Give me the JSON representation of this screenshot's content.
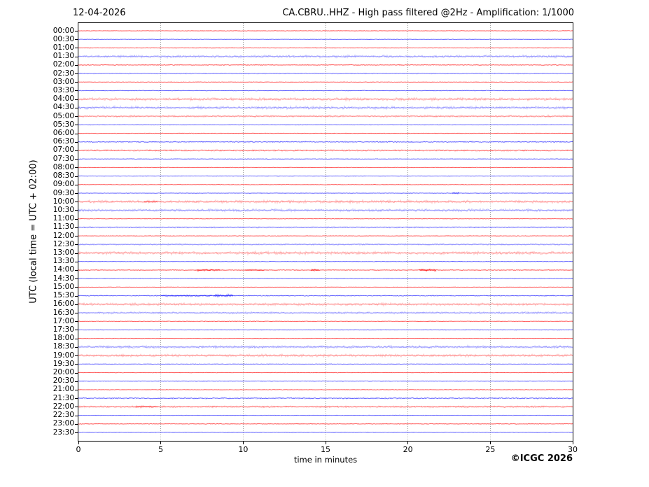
{
  "header": {
    "date": "12-04-2026",
    "title": "CA.CBRU..HHZ - High pass filtered @2Hz - Amplification: 1/1000"
  },
  "footer": {
    "copyright": "©ICGC 2026"
  },
  "chart_data": {
    "type": "line",
    "subtype": "helicorder-seismogram",
    "title": "CA.CBRU..HHZ - High pass filtered @2Hz - Amplification: 1/1000",
    "date": "12-04-2026",
    "xlabel": "time in minutes",
    "ylabel": "UTC (local time = UTC + 02:00)",
    "xlim": [
      0,
      30
    ],
    "x_ticks": [
      0,
      5,
      10,
      15,
      20,
      25,
      30
    ],
    "grid": {
      "vertical_dotted_lines_min": [
        5,
        10,
        15,
        20,
        25
      ],
      "color": "#777777"
    },
    "minutes_per_line": 30,
    "rows_count": 48,
    "colors": {
      "trace_red": "#ff2020",
      "trace_blue": "#3030ff",
      "axis": "#000000",
      "background": "#ffffff"
    },
    "rows": [
      {
        "label": "00:00",
        "color": "red",
        "amplitude": 0.55,
        "tone": "normal",
        "events": []
      },
      {
        "label": "00:30",
        "color": "blue",
        "amplitude": 0.5,
        "tone": "normal",
        "events": []
      },
      {
        "label": "01:00",
        "color": "red",
        "amplitude": 0.7,
        "tone": "normal",
        "events": []
      },
      {
        "label": "01:30",
        "color": "blue",
        "amplitude": 1.3,
        "tone": "light",
        "events": []
      },
      {
        "label": "02:00",
        "color": "red",
        "amplitude": 0.8,
        "tone": "normal",
        "events": []
      },
      {
        "label": "02:30",
        "color": "blue",
        "amplitude": 0.6,
        "tone": "normal",
        "events": []
      },
      {
        "label": "03:00",
        "color": "red",
        "amplitude": 0.55,
        "tone": "normal",
        "events": []
      },
      {
        "label": "03:30",
        "color": "blue",
        "amplitude": 0.7,
        "tone": "normal",
        "events": []
      },
      {
        "label": "04:00",
        "color": "red",
        "amplitude": 1.4,
        "tone": "light",
        "events": []
      },
      {
        "label": "04:30",
        "color": "blue",
        "amplitude": 1.4,
        "tone": "light",
        "events": []
      },
      {
        "label": "05:00",
        "color": "red",
        "amplitude": 1.0,
        "tone": "light",
        "events": []
      },
      {
        "label": "05:30",
        "color": "blue",
        "amplitude": 0.55,
        "tone": "normal",
        "events": []
      },
      {
        "label": "06:00",
        "color": "red",
        "amplitude": 0.6,
        "tone": "normal",
        "events": []
      },
      {
        "label": "06:30",
        "color": "blue",
        "amplitude": 1.1,
        "tone": "normal",
        "events": []
      },
      {
        "label": "07:00",
        "color": "red",
        "amplitude": 1.3,
        "tone": "normal",
        "events": []
      },
      {
        "label": "07:30",
        "color": "blue",
        "amplitude": 0.6,
        "tone": "normal",
        "events": []
      },
      {
        "label": "08:00",
        "color": "red",
        "amplitude": 0.6,
        "tone": "normal",
        "events": []
      },
      {
        "label": "08:30",
        "color": "blue",
        "amplitude": 0.5,
        "tone": "normal",
        "events": []
      },
      {
        "label": "09:00",
        "color": "red",
        "amplitude": 0.5,
        "tone": "normal",
        "events": []
      },
      {
        "label": "09:30",
        "color": "blue",
        "amplitude": 0.5,
        "tone": "normal",
        "events": [
          {
            "start_min": 22.7,
            "end_min": 23.1,
            "amplitude": 1.1,
            "opacity": 0.8
          }
        ]
      },
      {
        "label": "10:00",
        "color": "red",
        "amplitude": 1.4,
        "tone": "light",
        "events": [
          {
            "start_min": 4.0,
            "end_min": 4.8,
            "amplitude": 1.2,
            "opacity": 0.5
          }
        ]
      },
      {
        "label": "10:30",
        "color": "blue",
        "amplitude": 1.3,
        "tone": "light",
        "events": []
      },
      {
        "label": "11:00",
        "color": "red",
        "amplitude": 0.55,
        "tone": "normal",
        "events": []
      },
      {
        "label": "11:30",
        "color": "blue",
        "amplitude": 1.0,
        "tone": "normal",
        "events": []
      },
      {
        "label": "12:00",
        "color": "red",
        "amplitude": 0.55,
        "tone": "normal",
        "events": []
      },
      {
        "label": "12:30",
        "color": "blue",
        "amplitude": 0.8,
        "tone": "light",
        "events": []
      },
      {
        "label": "13:00",
        "color": "red",
        "amplitude": 1.4,
        "tone": "light",
        "events": []
      },
      {
        "label": "13:30",
        "color": "blue",
        "amplitude": 0.55,
        "tone": "normal",
        "events": []
      },
      {
        "label": "14:00",
        "color": "red",
        "amplitude": 0.8,
        "tone": "normal",
        "events": [
          {
            "start_min": 7.2,
            "end_min": 8.6,
            "amplitude": 1.3,
            "opacity": 0.85
          },
          {
            "start_min": 10.1,
            "end_min": 11.3,
            "amplitude": 1.0,
            "opacity": 0.6
          },
          {
            "start_min": 14.1,
            "end_min": 14.6,
            "amplitude": 1.2,
            "opacity": 0.8
          },
          {
            "start_min": 20.7,
            "end_min": 21.7,
            "amplitude": 1.5,
            "opacity": 0.95
          }
        ]
      },
      {
        "label": "14:30",
        "color": "blue",
        "amplitude": 0.5,
        "tone": "normal",
        "events": []
      },
      {
        "label": "15:00",
        "color": "red",
        "amplitude": 0.5,
        "tone": "normal",
        "events": []
      },
      {
        "label": "15:30",
        "color": "blue",
        "amplitude": 0.9,
        "tone": "normal",
        "events": [
          {
            "start_min": 5.0,
            "end_min": 8.1,
            "amplitude": 1.1,
            "opacity": 0.65
          },
          {
            "start_min": 8.2,
            "end_min": 9.4,
            "amplitude": 1.6,
            "opacity": 0.9
          }
        ]
      },
      {
        "label": "16:00",
        "color": "red",
        "amplitude": 1.2,
        "tone": "light",
        "events": []
      },
      {
        "label": "16:30",
        "color": "blue",
        "amplitude": 1.0,
        "tone": "light",
        "events": []
      },
      {
        "label": "17:00",
        "color": "red",
        "amplitude": 0.6,
        "tone": "normal",
        "events": []
      },
      {
        "label": "17:30",
        "color": "blue",
        "amplitude": 0.6,
        "tone": "normal",
        "events": []
      },
      {
        "label": "18:00",
        "color": "red",
        "amplitude": 0.55,
        "tone": "normal",
        "events": []
      },
      {
        "label": "18:30",
        "color": "blue",
        "amplitude": 1.3,
        "tone": "light",
        "events": []
      },
      {
        "label": "19:00",
        "color": "red",
        "amplitude": 1.3,
        "tone": "light",
        "events": []
      },
      {
        "label": "19:30",
        "color": "blue",
        "amplitude": 0.5,
        "tone": "normal",
        "events": []
      },
      {
        "label": "20:00",
        "color": "red",
        "amplitude": 0.6,
        "tone": "normal",
        "events": []
      },
      {
        "label": "20:30",
        "color": "blue",
        "amplitude": 0.6,
        "tone": "normal",
        "events": []
      },
      {
        "label": "21:00",
        "color": "red",
        "amplitude": 0.5,
        "tone": "normal",
        "events": []
      },
      {
        "label": "21:30",
        "color": "blue",
        "amplitude": 1.2,
        "tone": "normal",
        "events": []
      },
      {
        "label": "22:00",
        "color": "red",
        "amplitude": 1.2,
        "tone": "normal",
        "events": [
          {
            "start_min": 3.5,
            "end_min": 4.8,
            "amplitude": 1.3,
            "opacity": 0.55
          }
        ]
      },
      {
        "label": "22:30",
        "color": "blue",
        "amplitude": 0.5,
        "tone": "normal",
        "events": []
      },
      {
        "label": "23:00",
        "color": "red",
        "amplitude": 0.6,
        "tone": "normal",
        "events": []
      },
      {
        "label": "23:30",
        "color": "blue",
        "amplitude": 0.5,
        "tone": "normal",
        "events": []
      }
    ]
  }
}
